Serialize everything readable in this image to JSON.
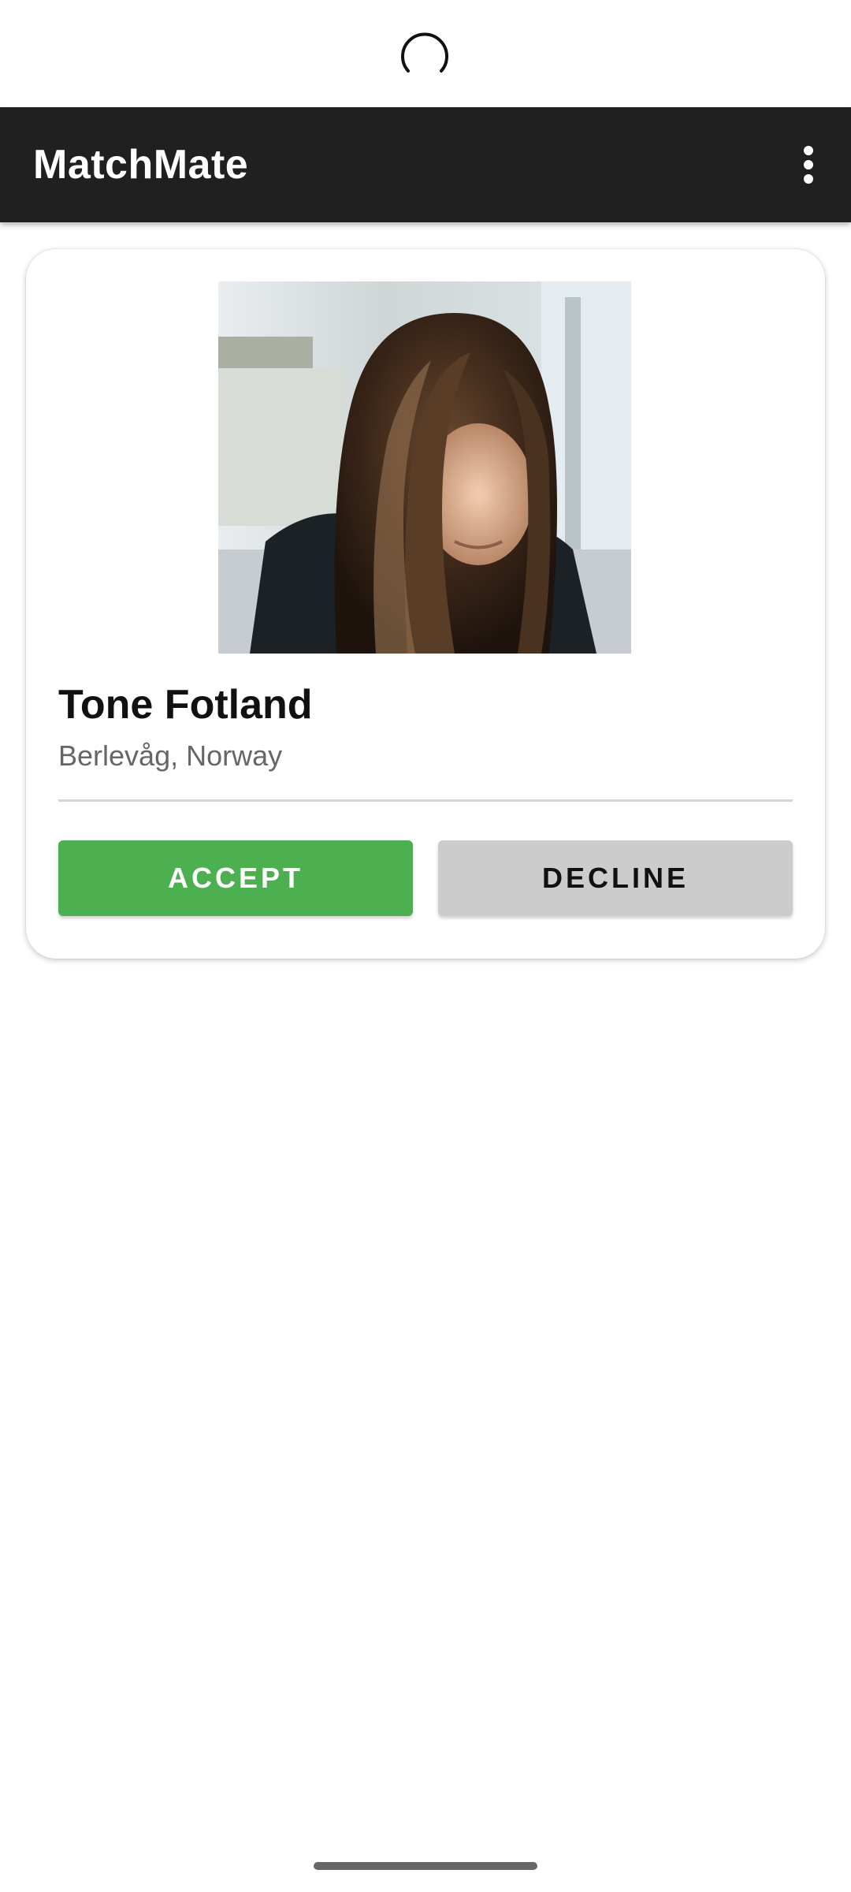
{
  "app_bar": {
    "title": "MatchMate",
    "menu_icon": "more-vert-icon"
  },
  "status_bar": {
    "indicator_icon": "loading-spinner-icon"
  },
  "profile_card": {
    "photo_icon": "profile-photo",
    "name": "Tone Fotland",
    "location": "Berlevåg, Norway",
    "accept_label": "ACCEPT",
    "decline_label": "DECLINE"
  },
  "colors": {
    "app_bar": "#202020",
    "accept": "#4caf50",
    "decline": "#cccccc"
  }
}
